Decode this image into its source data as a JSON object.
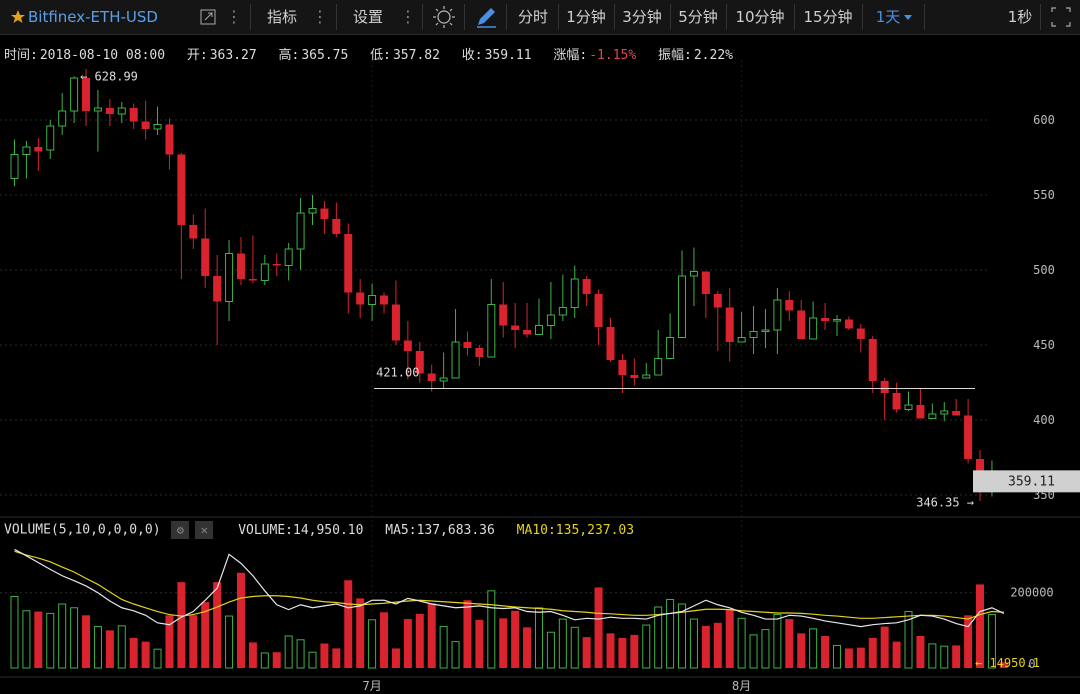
{
  "toolbar": {
    "symbol": "Bitfinex-ETH-USD",
    "star_color": "#e3a21a",
    "indicators_label": "指标",
    "settings_label": "设置",
    "dots": "⋮",
    "periods": [
      "分时",
      "1分钟",
      "3分钟",
      "5分钟",
      "10分钟",
      "15分钟"
    ],
    "selected_period": "1天",
    "right_label": "1秒"
  },
  "info": {
    "time_label": "时间:",
    "time_value": "2018-08-10 08:00",
    "open_label": "开:",
    "open_value": "363.27",
    "high_label": "高:",
    "high_value": "365.75",
    "low_label": "低:",
    "low_value": "357.82",
    "close_label": "收:",
    "close_value": "359.11",
    "change_label": "涨幅:",
    "change_value": "-1.15%",
    "amplitude_label": "振幅:",
    "amplitude_value": "2.22%"
  },
  "volume_info": {
    "label": "VOLUME(5,10,0,0,0,0)",
    "volume_text": "VOLUME:14,950.10",
    "ma5_text": "MA5:137,683.36",
    "ma10_text": "MA10:135,237.03",
    "gear_icon": "⚙",
    "close_icon": "✕"
  },
  "chart_data": {
    "type": "candlestick",
    "up_color": "#3fb24a",
    "down_color": "#d9232e",
    "ma5_color": "#e8e8e8",
    "ma10_color": "#e6d21a",
    "price_ylim": [
      340,
      640
    ],
    "price_ticks": [
      350,
      400,
      450,
      500,
      550,
      600
    ],
    "volume_ticks": [
      {
        "label": "200000",
        "value": 200000
      },
      {
        "label": "0",
        "value": 0
      }
    ],
    "volume_ylim": [
      0,
      340000
    ],
    "x_labels": [
      {
        "label": "7月",
        "index": 30
      },
      {
        "label": "8月",
        "index": 61
      }
    ],
    "max_label": "628.99",
    "min_label": "346.35",
    "current_price_label": "359.11",
    "current_volume_label": "14950.1",
    "support_line_label": "421.00",
    "support_line_value": 421,
    "candles": [
      [
        561,
        577,
        556,
        587,
        190000
      ],
      [
        577,
        582,
        561,
        586,
        152000
      ],
      [
        582,
        579,
        566,
        588,
        150000
      ],
      [
        580,
        596,
        574,
        600,
        145000
      ],
      [
        596,
        606,
        590,
        618,
        170000
      ],
      [
        606,
        628,
        598,
        629,
        160000
      ],
      [
        628,
        606,
        596,
        634,
        140000
      ],
      [
        606,
        608,
        579,
        620,
        110000
      ],
      [
        608,
        604,
        596,
        614,
        100000
      ],
      [
        604,
        608,
        598,
        612,
        112000
      ],
      [
        608,
        599,
        594,
        611,
        80000
      ],
      [
        599,
        594,
        587,
        613,
        70000
      ],
      [
        594,
        597,
        590,
        609,
        50000
      ],
      [
        597,
        577,
        567,
        601,
        140000
      ],
      [
        577,
        530,
        494,
        578,
        228000
      ],
      [
        530,
        521,
        514,
        537,
        140000
      ],
      [
        521,
        496,
        488,
        541,
        175000
      ],
      [
        496,
        479,
        450,
        510,
        228000
      ],
      [
        479,
        511,
        466,
        520,
        138000
      ],
      [
        511,
        494,
        490,
        522,
        253000
      ],
      [
        494,
        493,
        491,
        523,
        68000
      ],
      [
        493,
        504,
        490,
        510,
        40000
      ],
      [
        504,
        503,
        496,
        511,
        42000
      ],
      [
        503,
        514,
        493,
        518,
        85000
      ],
      [
        514,
        538,
        500,
        548,
        75000
      ],
      [
        538,
        541,
        530,
        550,
        42000
      ],
      [
        541,
        534,
        524,
        546,
        65000
      ],
      [
        534,
        524,
        522,
        545,
        52000
      ],
      [
        524,
        485,
        471,
        531,
        233000
      ],
      [
        485,
        477,
        468,
        494,
        185000
      ],
      [
        477,
        483,
        466,
        491,
        128000
      ],
      [
        483,
        477,
        471,
        485,
        148000
      ],
      [
        477,
        453,
        450,
        493,
        52000
      ],
      [
        453,
        446,
        427,
        466,
        130000
      ],
      [
        446,
        431,
        425,
        452,
        144000
      ],
      [
        431,
        426,
        419,
        437,
        172000
      ],
      [
        426,
        428,
        421,
        445,
        110000
      ],
      [
        428,
        452,
        438,
        474,
        70000
      ],
      [
        452,
        448,
        443,
        459,
        180000
      ],
      [
        448,
        442,
        436,
        450,
        128000
      ],
      [
        442,
        477,
        445,
        494,
        205000
      ],
      [
        477,
        463,
        455,
        492,
        132000
      ],
      [
        463,
        460,
        448,
        478,
        152000
      ],
      [
        460,
        457,
        455,
        478,
        108000
      ],
      [
        457,
        463,
        459,
        481,
        160000
      ],
      [
        463,
        470,
        454,
        492,
        95000
      ],
      [
        470,
        475,
        466,
        497,
        130000
      ],
      [
        475,
        494,
        468,
        503,
        108000
      ],
      [
        494,
        484,
        476,
        496,
        82000
      ],
      [
        484,
        462,
        450,
        487,
        214000
      ],
      [
        462,
        440,
        439,
        468,
        92000
      ],
      [
        440,
        430,
        418,
        444,
        80000
      ],
      [
        430,
        428,
        423,
        441,
        88000
      ],
      [
        428,
        430,
        428,
        438,
        114000
      ],
      [
        430,
        441,
        430,
        460,
        162000
      ],
      [
        441,
        455,
        441,
        471,
        182000
      ],
      [
        455,
        496,
        462,
        513,
        170000
      ],
      [
        496,
        499,
        476,
        515,
        130000
      ],
      [
        499,
        484,
        468,
        486,
        112000
      ],
      [
        484,
        475,
        446,
        486,
        120000
      ],
      [
        475,
        452,
        439,
        488,
        155000
      ],
      [
        452,
        455,
        453,
        472,
        132000
      ],
      [
        455,
        459,
        444,
        476,
        88000
      ],
      [
        459,
        460,
        448,
        474,
        102000
      ],
      [
        460,
        480,
        444,
        488,
        142000
      ],
      [
        480,
        473,
        466,
        486,
        130000
      ],
      [
        473,
        454,
        456,
        480,
        92000
      ],
      [
        454,
        468,
        459,
        479,
        104000
      ],
      [
        468,
        466,
        460,
        478,
        85000
      ],
      [
        466,
        467,
        456,
        470,
        60000
      ],
      [
        467,
        461,
        460,
        469,
        52000
      ],
      [
        461,
        454,
        445,
        464,
        54000
      ],
      [
        454,
        426,
        418,
        456,
        80000
      ],
      [
        426,
        418,
        400,
        428,
        110000
      ],
      [
        418,
        407,
        405,
        425,
        70000
      ],
      [
        407,
        410,
        406,
        419,
        150000
      ],
      [
        410,
        401,
        409,
        421,
        85000
      ],
      [
        401,
        404,
        402,
        411,
        64000
      ],
      [
        404,
        406,
        399,
        412,
        58000
      ],
      [
        406,
        403,
        405,
        414,
        60000
      ],
      [
        403,
        374,
        371,
        414,
        140000
      ],
      [
        374,
        353,
        346,
        380,
        222000
      ],
      [
        353,
        363,
        349,
        373,
        142000
      ],
      [
        363,
        359,
        357,
        366,
        14950
      ]
    ],
    "ma5": [
      315000,
      298000,
      280000,
      262000,
      245000,
      232000,
      218000,
      200000,
      178000,
      160000,
      152000,
      140000,
      120000,
      115000,
      135000,
      150000,
      180000,
      212000,
      302000,
      278000,
      245000,
      205000,
      168000,
      155000,
      168000,
      160000,
      165000,
      170000,
      160000,
      165000,
      180000,
      180000,
      170000,
      185000,
      178000,
      170000,
      165000,
      160000,
      162000,
      165000,
      160000,
      158000,
      160000,
      150000,
      148000,
      150000,
      140000,
      128000,
      132000,
      130000,
      135000,
      132000,
      132000,
      130000,
      140000,
      145000,
      150000,
      165000,
      180000,
      168000,
      160000,
      148000,
      140000,
      130000,
      130000,
      140000,
      138000,
      132000,
      125000,
      120000,
      115000,
      110000,
      115000,
      118000,
      120000,
      128000,
      140000,
      138000,
      130000,
      118000,
      110000,
      150000,
      160000,
      145000
    ],
    "ma10": [
      310000,
      300000,
      292000,
      282000,
      268000,
      255000,
      238000,
      222000,
      202000,
      182000,
      170000,
      160000,
      150000,
      142000,
      138000,
      142000,
      150000,
      162000,
      175000,
      186000,
      190000,
      192000,
      192000,
      190000,
      186000,
      180000,
      176000,
      174000,
      170000,
      168000,
      170000,
      172000,
      175000,
      178000,
      180000,
      178000,
      176000,
      174000,
      172000,
      170000,
      168000,
      165000,
      162000,
      160000,
      158000,
      156000,
      152000,
      150000,
      148000,
      145000,
      144000,
      142000,
      140000,
      140000,
      142000,
      145000,
      148000,
      152000,
      156000,
      156000,
      155000,
      152000,
      150000,
      148000,
      146000,
      146000,
      145000,
      143000,
      140000,
      138000,
      135000,
      132000,
      132000,
      134000,
      136000,
      138000,
      140000,
      140000,
      138000,
      134000,
      130000,
      142000,
      150000,
      148000
    ]
  }
}
